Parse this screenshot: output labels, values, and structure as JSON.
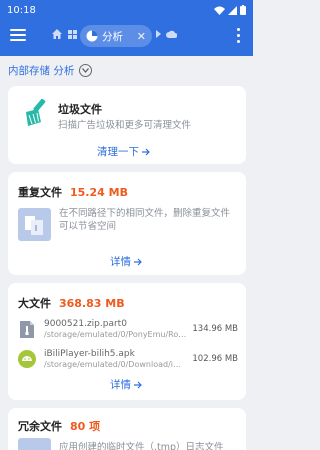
{
  "status": {
    "time": "10:18"
  },
  "toolbar": {
    "tab_label": "分析",
    "tab_close": "✕"
  },
  "location": {
    "label": "内部存储 分析"
  },
  "junk_card": {
    "title": "垃圾文件",
    "description": "扫描广告垃圾和更多可清理文件",
    "action": "清理一下"
  },
  "duplicate_card": {
    "title": "重复文件",
    "size": "15.24 MB",
    "description": "在不同路径下的相同文件，删除重复文件可以节省空间",
    "action": "详情"
  },
  "large_card": {
    "title": "大文件",
    "size": "368.83 MB",
    "files": [
      {
        "name": "9000521.zip.part0",
        "path": "/storage/emulated/0/PonyEmu/Rom...",
        "size": "134.96 MB"
      },
      {
        "name": "iBiliPlayer-bilih5.apk",
        "path": "/storage/emulated/0/Download/iBili...",
        "size": "102.96 MB"
      }
    ],
    "action": "详情"
  },
  "redundant_card": {
    "title": "冗余文件",
    "count": "80 项",
    "description": "应用创建的临时文件（.tmp）日志文件"
  },
  "colors": {
    "primary": "#2f6fe0",
    "accent": "#ef5a1f",
    "background": "#eef0f4"
  },
  "icons": [
    "menu-icon",
    "home-icon",
    "grid-icon",
    "pie-chart-icon",
    "close-icon",
    "cloud-icon",
    "more-vert-icon",
    "chevron-down-icon",
    "broom-icon",
    "duplicate-files-icon",
    "archive-file-icon",
    "android-apk-icon",
    "arrow-right-icon"
  ]
}
